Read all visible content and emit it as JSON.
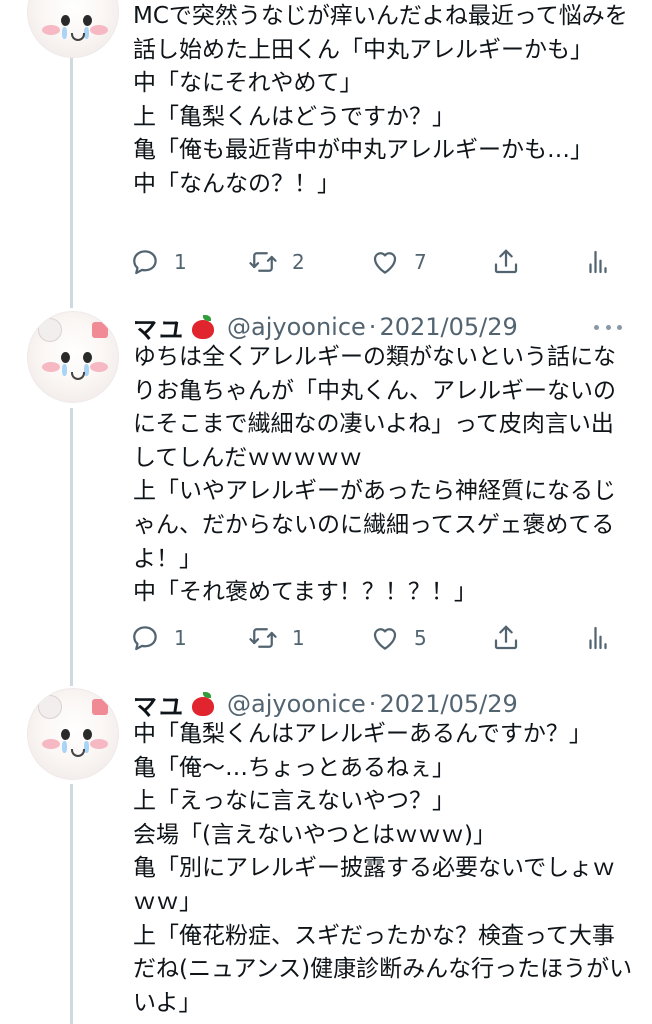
{
  "tweets": [
    {
      "body": "MCで突然うなじが痒いんだよね最近って悩みを話し始めた上田くん「中丸アレルギーかも」\n中「なにそれやめて」\n上「亀梨くんはどうですか？」\n亀「俺も最近背中が中丸アレルギーかも…」\n中「なんなの？！」",
      "reply_count": "1",
      "retweet_count": "2",
      "like_count": "7"
    },
    {
      "display_name": "マユ",
      "handle": "@ajyoonice",
      "separator": "·",
      "date": "2021/05/29",
      "body": "ゆちは全くアレルギーの類がないという話になりお亀ちゃんが「中丸くん、アレルギーないのにそこまで繊細なの凄いよね」って皮肉言い出してしんだｗｗｗｗｗ\n上「いやアレルギーがあったら神経質になるじゃん、だからないのに繊細ってスゲェ褒めてるよ！」\n中「それ褒めてます！？！？！」",
      "reply_count": "1",
      "retweet_count": "1",
      "like_count": "5"
    },
    {
      "display_name": "マユ",
      "handle": "@ajyoonice",
      "separator": "·",
      "date": "2021/05/29",
      "body": "中「亀梨くんはアレルギーあるんですか？」\n亀「俺〜…ちょっとあるねぇ」\n上「えっなに言えないやつ？」\n会場「(言えないやつとはｗｗｗ)」\n亀「別にアレルギー披露する必要ないでしょｗｗｗ」\n上「俺花粉症、スギだったかな？検査って大事だね(ニュアンス)健康診断みんな行ったほうがいいよ」"
    }
  ],
  "icons": {
    "reply": "reply-icon",
    "retweet": "retweet-icon",
    "like": "heart-icon",
    "share": "share-icon",
    "analytics": "analytics-icon",
    "more": "more-icon",
    "emoji": "red-apple-icon"
  },
  "colors": {
    "text": "#0f1419",
    "secondary": "#536471",
    "thread_line": "#cfd9de",
    "apple_red": "#e0252e"
  }
}
